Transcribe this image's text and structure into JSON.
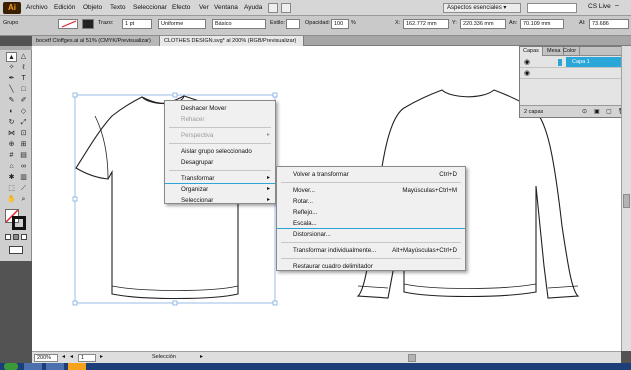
{
  "menubar": {
    "logo": "Ai",
    "items": [
      "Archivo",
      "Edición",
      "Objeto",
      "Texto",
      "Seleccionar",
      "Efecto",
      "Ver",
      "Ventana",
      "Ayuda"
    ],
    "workspace": "Aspectos esenciales",
    "cslive": "CS Live"
  },
  "controlbar": {
    "group_label": "Grupo",
    "stroke_label": "Trazo:",
    "stroke_value": "1 pt",
    "profile_value": "Uniforme",
    "brush_value": "Básico",
    "style_label": "Estilo:",
    "opacity_label": "Opacidad:",
    "opacity_value": "100",
    "opacity_unit": "%",
    "x_label": "X:",
    "x_value": "162.772 mm",
    "y_label": "Y:",
    "y_value": "220.336 mm",
    "w_label": "An:",
    "w_value": "70.109 mm",
    "h_label": "Al:",
    "h_value": "73.686"
  },
  "tabs": [
    {
      "label": "bocetf Cloffges.ai al 51% (CMYK/Previsualizar)"
    },
    {
      "label": "CLOTHES DESIGN.svg* al 200% (RGB/Previsualizar)"
    }
  ],
  "layers_panel": {
    "tabs": [
      "Capas",
      "Mesa",
      "Color"
    ],
    "layer_name": "Capa 1",
    "footer": "2 capas"
  },
  "context_menu": {
    "items": [
      {
        "label": "Deshacer Mover",
        "disabled": false
      },
      {
        "label": "Rehacer",
        "disabled": true
      },
      {
        "label": "Perspectiva",
        "disabled": true,
        "submenu": true
      },
      {
        "label": "Aislar grupo seleccionado",
        "disabled": false
      },
      {
        "label": "Desagrupar",
        "disabled": false
      },
      {
        "label": "Transformar",
        "disabled": false,
        "submenu": true
      },
      {
        "label": "Organizar",
        "disabled": false,
        "submenu": true
      },
      {
        "label": "Seleccionar",
        "disabled": false,
        "submenu": true
      }
    ]
  },
  "submenu": {
    "items": [
      {
        "label": "Volver a transformar",
        "shortcut": "Ctrl+D"
      },
      {
        "label": "Mover...",
        "shortcut": "Mayúsculas+Ctrl+M"
      },
      {
        "label": "Rotar...",
        "shortcut": ""
      },
      {
        "label": "Reflejo...",
        "shortcut": ""
      },
      {
        "label": "Escala...",
        "shortcut": ""
      },
      {
        "label": "Distorsionar...",
        "shortcut": ""
      },
      {
        "label": "Transformar individualmente...",
        "shortcut": "Alt+Mayúsculas+Ctrl+D"
      },
      {
        "label": "Restaurar cuadro delimitador",
        "shortcut": ""
      }
    ]
  },
  "statusbar": {
    "zoom": "200%",
    "page": "1",
    "tool": "Selección"
  },
  "colors": {
    "accent": "#2aa6d8",
    "selection": "#6fa0e0"
  }
}
